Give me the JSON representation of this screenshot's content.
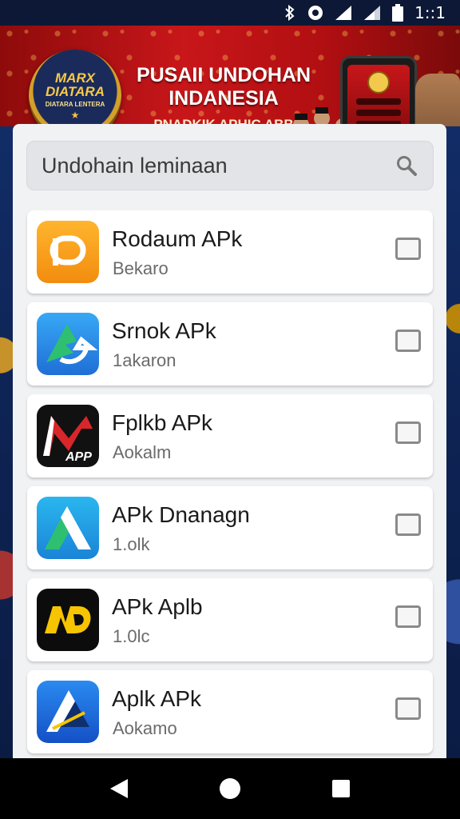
{
  "status_bar": {
    "time": "1::1",
    "icons": [
      "bluetooth-icon",
      "data-saver-icon",
      "signal-icon",
      "wifi-signal-icon",
      "battery-icon"
    ]
  },
  "banner": {
    "logo_text": "MARX DIATARA",
    "logo_sub": "DIATARA LENTERA",
    "title_line1": "PUSAII UNDOHAN",
    "title_line2": "INDANESIA",
    "subtitle": "PNADKIK APHIC ABB"
  },
  "search": {
    "placeholder": "Undohain leminaan",
    "icon": "search-icon"
  },
  "apps": [
    {
      "name": "Rodaum APk",
      "sub": "Bekaro",
      "icon": "orange-p-icon",
      "color": "#f6a21a"
    },
    {
      "name": "Srnok APk",
      "sub": "1akaron",
      "icon": "blue-arrow-icon",
      "color": "#2d87e6"
    },
    {
      "name": "Fplkb APk",
      "sub": "Aokalm",
      "icon": "red-black-app-icon",
      "color": "#d8262b"
    },
    {
      "name": "APk Dnanagn",
      "sub": "1.olk",
      "icon": "teal-a-icon",
      "color": "#1ea0e0"
    },
    {
      "name": "APk Aplb",
      "sub": "1.0lc",
      "icon": "yellow-nd-icon",
      "color": "#f6c400"
    },
    {
      "name": "Aplk APk",
      "sub": "Aokamo",
      "icon": "blue-a-icon",
      "color": "#1e6fd9"
    }
  ],
  "nav": {
    "back": "back-icon",
    "home": "home-icon",
    "recents": "recents-icon"
  }
}
